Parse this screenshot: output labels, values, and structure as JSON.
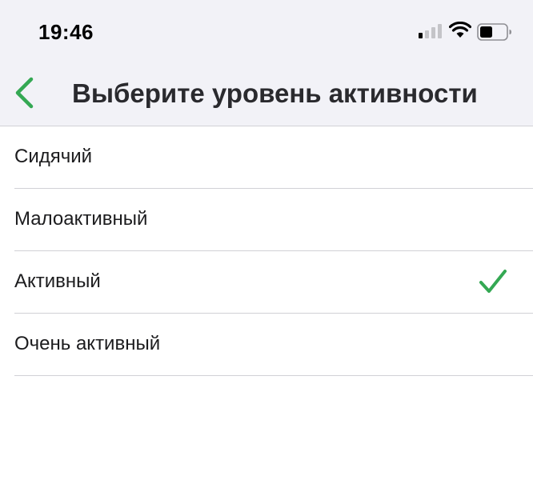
{
  "status_bar": {
    "time": "19:46",
    "icons": [
      "cellular-signal-icon",
      "wifi-icon",
      "battery-icon"
    ]
  },
  "nav": {
    "back_icon": "chevron-left-icon",
    "title": "Выберите уровень активности"
  },
  "activity_levels": [
    {
      "label": "Сидячий",
      "selected": false
    },
    {
      "label": "Малоактивный",
      "selected": false
    },
    {
      "label": "Активный",
      "selected": true
    },
    {
      "label": "Очень активный",
      "selected": false
    }
  ],
  "colors": {
    "accent": "#34a853",
    "header_bg": "#f2f2f7",
    "separator": "#d1d1d6"
  }
}
